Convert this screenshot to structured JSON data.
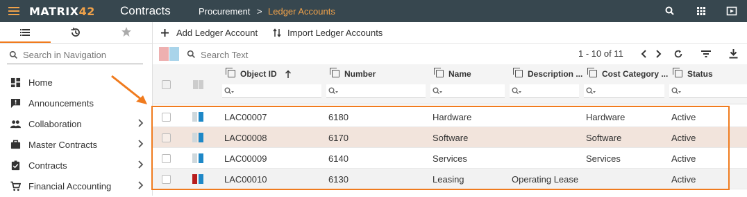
{
  "topbar": {
    "logo_main": "MATRIX",
    "logo_num": "42",
    "app_title": "Contracts",
    "breadcrumb_parent": "Procurement",
    "breadcrumb_sep": ">",
    "breadcrumb_current": "Ledger Accounts"
  },
  "nav": {
    "search_placeholder": "Search in Navigation",
    "items": [
      {
        "label": "Home",
        "icon": "dashboard-icon",
        "chevron": false
      },
      {
        "label": "Announcements",
        "icon": "announcement-icon",
        "chevron": false
      },
      {
        "label": "Collaboration",
        "icon": "people-icon",
        "chevron": true
      },
      {
        "label": "Master Contracts",
        "icon": "briefcase-icon",
        "chevron": true
      },
      {
        "label": "Contracts",
        "icon": "clipboard-check-icon",
        "chevron": true
      },
      {
        "label": "Financial Accounting",
        "icon": "cart-icon",
        "chevron": true
      }
    ]
  },
  "toolbar": {
    "add_label": "Add Ledger Account",
    "import_label": "Import Ledger Accounts"
  },
  "grid": {
    "search_placeholder": "Search Text",
    "pager": "1 - 10 of 11",
    "columns": [
      "Object ID",
      "Number",
      "Name",
      "Description ...",
      "Cost Category ...",
      "Status"
    ],
    "rows": [
      {
        "id": "LAC00007",
        "number": "6180",
        "name": "Hardware",
        "description": "",
        "cost_category": "Hardware",
        "status": "Active",
        "marker": "#cfd8dc"
      },
      {
        "id": "LAC00008",
        "number": "6170",
        "name": "Software",
        "description": "",
        "cost_category": "Software",
        "status": "Active",
        "marker": "#cfd8dc"
      },
      {
        "id": "LAC00009",
        "number": "6140",
        "name": "Services",
        "description": "",
        "cost_category": "Services",
        "status": "Active",
        "marker": "#cfd8dc"
      },
      {
        "id": "LAC00010",
        "number": "6130",
        "name": "Leasing",
        "description": "Operating Lease",
        "cost_category": "",
        "status": "Active",
        "marker": "#b71c1c"
      }
    ]
  },
  "colors": {
    "accent": "#f07b1e",
    "topbar": "#37474f",
    "row_selected": "#f2e4dc",
    "row_alt": "#f2f2f2",
    "status_blue": "#1e88c7"
  }
}
